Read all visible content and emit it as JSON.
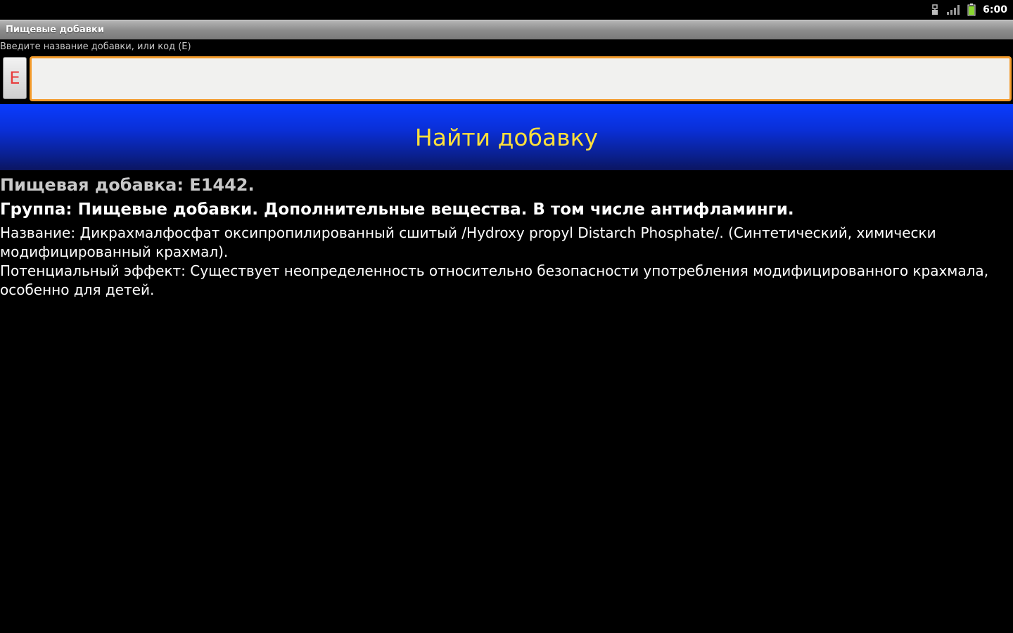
{
  "status_bar": {
    "time": "6:00",
    "icons": [
      "usb-debug-icon",
      "signal-icon",
      "battery-icon"
    ],
    "battery_color": "#8ad630"
  },
  "app": {
    "title": "Пищевые добавки"
  },
  "search": {
    "hint": "Введите название добавки, или код (E)",
    "prefix": "E",
    "value": "",
    "border_color": "#f39b2b"
  },
  "find_button": {
    "label": "Найти добавку",
    "text_color": "#ffe03a",
    "bg_color": "#0a2fd6"
  },
  "result": {
    "code_line": "Пищевая добавка: E1442.",
    "group_line": "Группа: Пищевые добавки. Дополнительные вещества. В том числе антифламинги.",
    "name_line": "Название: Дикрахмалфосфат оксипропилированный сшитый /Hydroxy propyl Distarch Phosphate/. (Синтетический, химически модифицированный крахмал).",
    "effect_line": "Потенциальный эффект: Существует неопределенность относительно безопасности употребления модифицированного крахмала, особенно для детей."
  }
}
